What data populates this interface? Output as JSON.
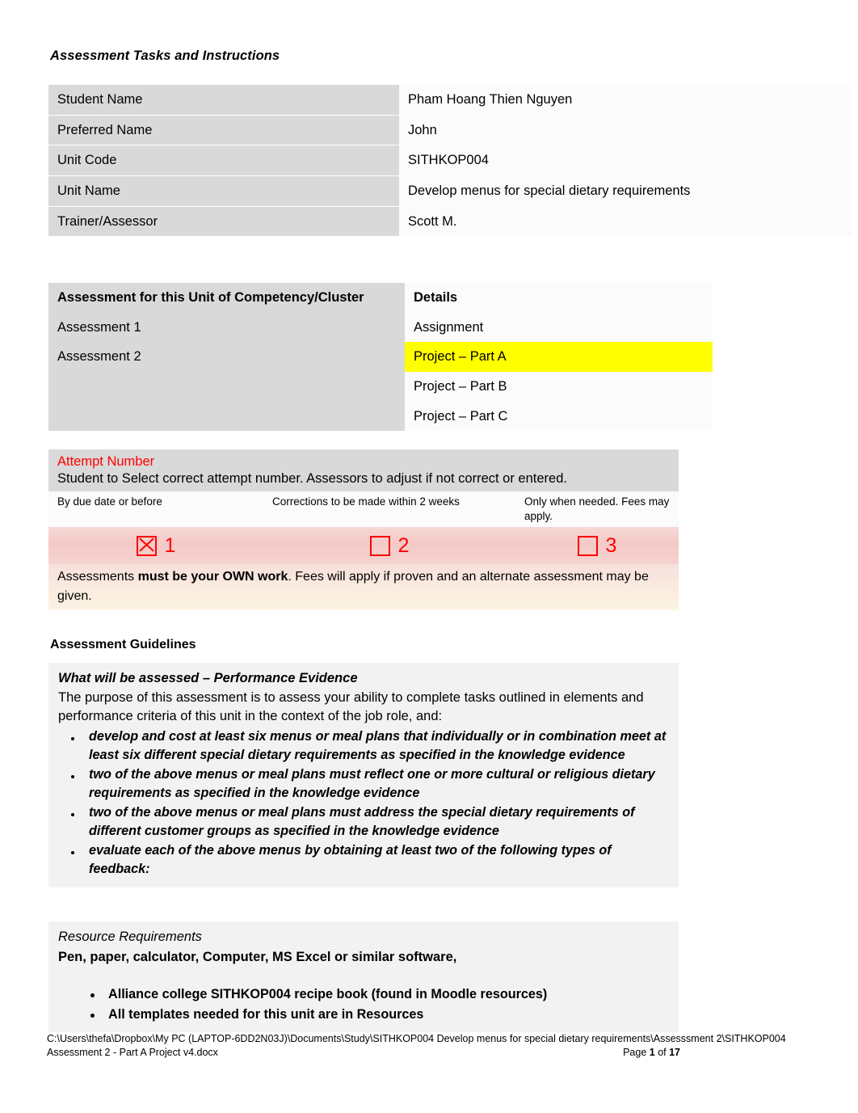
{
  "document": {
    "title": "Assessment Tasks and Instructions"
  },
  "student_table": {
    "rows": [
      {
        "label": "Student Name",
        "value": "Pham Hoang Thien Nguyen",
        "highlighted": false
      },
      {
        "label": "Preferred Name",
        "value": "John",
        "highlighted": false
      },
      {
        "label": "Unit Code",
        "value": "SITHKOP004",
        "highlighted": true
      },
      {
        "label": "Unit Name",
        "value": "Develop menus for special dietary requirements",
        "highlighted": true
      },
      {
        "label": "Trainer/Assessor",
        "value": "Scott M.",
        "highlighted": false
      }
    ]
  },
  "assessment_table": {
    "header_left": "Assessment for this Unit of Competency/Cluster",
    "header_right": "Details",
    "rows": [
      {
        "assessment": "Assessment 1",
        "detail": "Assignment",
        "highlighted": false
      },
      {
        "assessment": "Assessment 2",
        "detail": "Project – Part A",
        "highlighted": true
      },
      {
        "assessment": "",
        "detail": "Project – Part B",
        "highlighted": false
      },
      {
        "assessment": "",
        "detail": "Project – Part C",
        "highlighted": false
      }
    ]
  },
  "attempt": {
    "title": "Attempt Number",
    "title_color": "#ff0000",
    "instruction": "Student to Select correct attempt number. Assessors to adjust if not correct or entered.",
    "columns": [
      {
        "note": "By due date or before",
        "number": "1",
        "checked": true
      },
      {
        "note": "Corrections to be made within 2 weeks",
        "number": "2",
        "checked": false
      },
      {
        "note": "Only when needed. Fees may apply.",
        "number": "3",
        "checked": false
      }
    ],
    "footnote_part1": "Assessments ",
    "footnote_bold": "must be your OWN work",
    "footnote_part2": ". Fees will apply if proven and an alternate assessment may be given."
  },
  "guidelines": {
    "heading": "Assessment Guidelines",
    "subheading": "What will be assessed – Performance Evidence",
    "intro": "The purpose of this assessment is to assess your ability to complete tasks outlined in elements and performance criteria of this unit in the context of the job role, and:",
    "bullets": [
      "develop and cost at least six menus or meal plans that individually or in combination meet at least six different special dietary requirements as specified in the knowledge evidence",
      "two of the above menus or meal plans must reflect one or more cultural or religious dietary requirements as specified in the knowledge evidence",
      "two of the above menus or meal plans must address the special dietary requirements of different customer groups as specified in the knowledge evidence",
      "evaluate each of the above menus by obtaining at least two of the following types of feedback:"
    ]
  },
  "resources": {
    "title": "Resource Requirements",
    "line": "Pen, paper, calculator, Computer, MS Excel or similar software,",
    "bullets": [
      "Alliance college SITHKOP004 recipe book (found in Moodle resources)",
      "All templates needed for this unit are in Resources"
    ]
  },
  "footer": {
    "path": "C:\\Users\\thefa\\Dropbox\\My PC (LAPTOP-6DD2N03J)\\Documents\\Study\\SITHKOP004 Develop menus for special dietary requirements\\Assesssment 2\\SITHKOP004",
    "filename": "Assessment 2 - Part A Project v4.docx",
    "page_prefix": "Page ",
    "page_number": "1",
    "page_of": " of ",
    "page_total": "17"
  },
  "colors": {
    "highlight_yellow": "#ffff00",
    "label_gray": "#d9d9d9",
    "panel_gray": "#f2f2f2",
    "attempt_red": "#ff0000",
    "attempt_band_pink": "#f4c9c6"
  }
}
